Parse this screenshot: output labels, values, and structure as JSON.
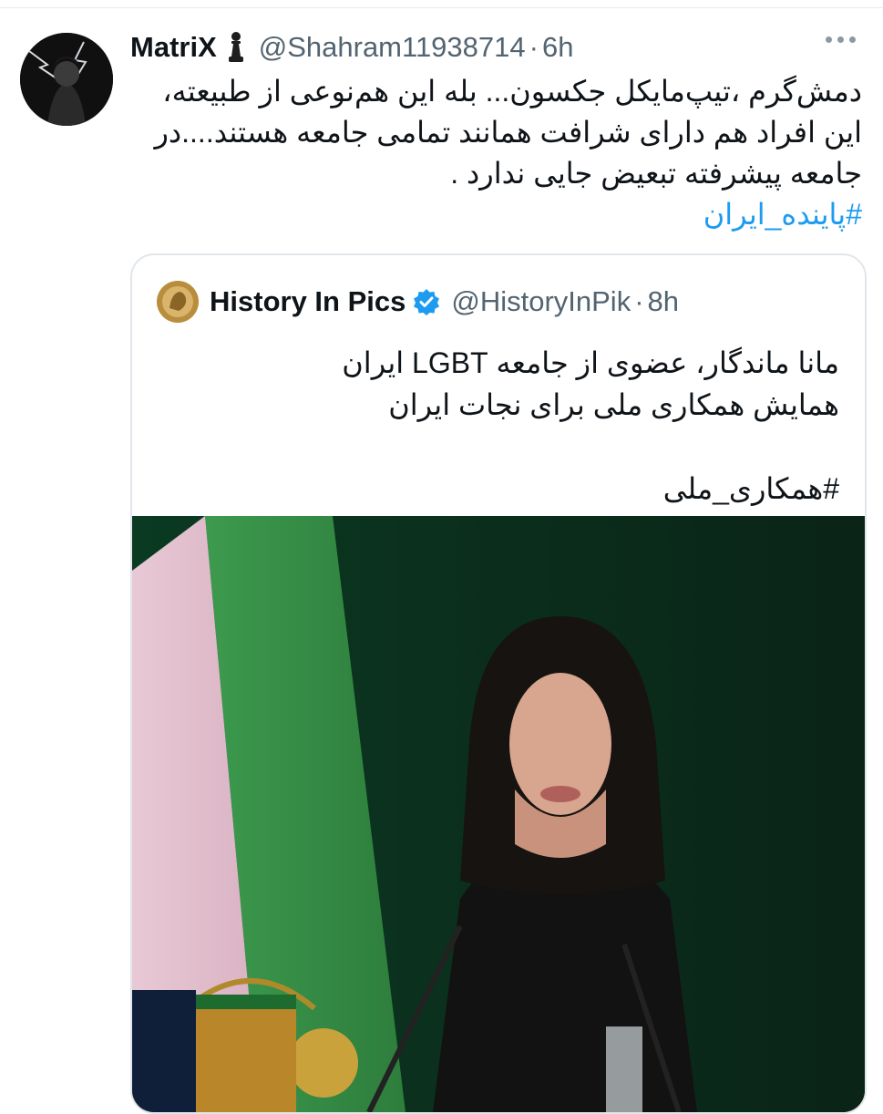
{
  "tweet": {
    "author_name": "MatriX",
    "author_badge_icon": "chess-pawn-icon",
    "handle": "@Shahram11938714",
    "separator": "·",
    "time": "6h",
    "text_lines": [
      "دمش‌گرم ،تیپ‌مایکل جکسون... بله این هم‌نوعی از طبیعته،",
      "این افراد هم دارای شرافت همانند تمامی جامعه هستند....در",
      "جامعه پیشرفته تبعیض جایی ندارد ."
    ],
    "hashtag": "#پاینده_ایران"
  },
  "quoted": {
    "author_name": "History In Pics",
    "verified_icon": "verified-badge-icon",
    "handle": "@HistoryInPik",
    "separator": "·",
    "time": "8h",
    "text_lines": [
      "مانا ماندگار، عضوی از جامعه LGBT ایران",
      "همایش همکاری ملی برای نجات ایران"
    ],
    "hashtag": "#همکاری_ملی"
  },
  "colors": {
    "link": "#1d9bf0",
    "secondary_text": "#536471",
    "verified": "#1d9bf0",
    "border": "#e1e6ea"
  }
}
